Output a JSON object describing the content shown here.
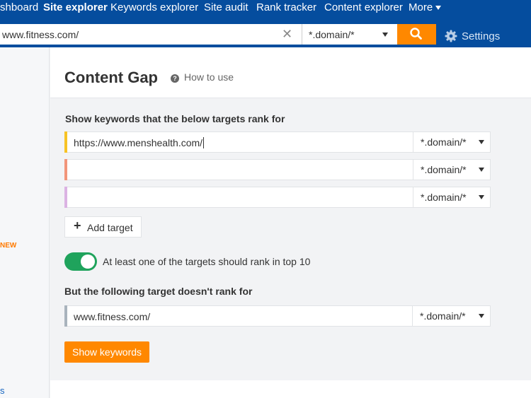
{
  "nav": {
    "items": [
      "shboard",
      "Site explorer",
      "Keywords explorer",
      "Site audit",
      "Rank tracker",
      "Content explorer",
      "More"
    ],
    "active_index": 1
  },
  "search": {
    "url_value": "www.fitness.com/",
    "mode": "*.domain/*",
    "settings_label": "Settings"
  },
  "sidebar": {
    "new_badge": "NEW",
    "bottom_text": "s"
  },
  "header": {
    "title": "Content Gap",
    "how_to_use": "How to use"
  },
  "targets": {
    "label": "Show keywords that the below targets rank for",
    "rows": [
      {
        "value": "https://www.menshealth.com/",
        "mode": "*.domain/*",
        "color": "#f7c325"
      },
      {
        "value": "",
        "mode": "*.domain/*",
        "color": "#f2957a"
      },
      {
        "value": "",
        "mode": "*.domain/*",
        "color": "#dbb3e3"
      }
    ],
    "add_target_label": "Add target"
  },
  "toggle": {
    "label": "At least one of the targets should rank in top 10",
    "on": true
  },
  "exclude": {
    "label": "But the following target doesn't rank for",
    "value": "www.fitness.com/",
    "mode": "*.domain/*",
    "color": "#a9b3bd"
  },
  "show_keywords_label": "Show keywords",
  "colors": {
    "nav_bg": "#054d9e",
    "accent_orange": "#ff8800",
    "toggle_green": "#1fa35c",
    "new_orange": "#ff7a00"
  }
}
